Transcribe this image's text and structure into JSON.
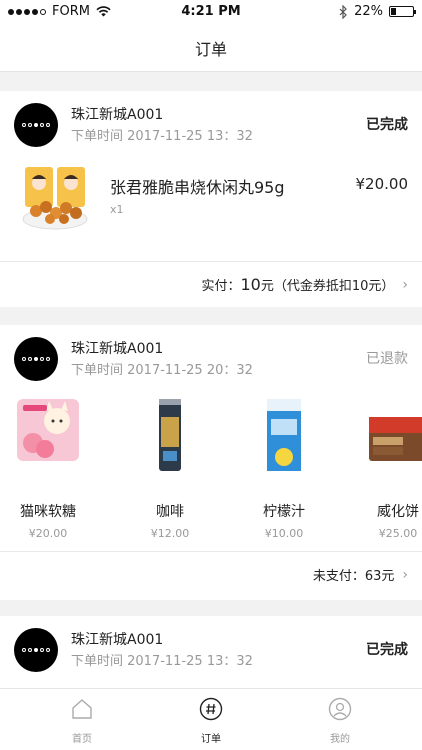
{
  "status_bar": {
    "carrier": "FORM",
    "time": "4:21 PM",
    "battery": "22%",
    "battery_level": 0.22
  },
  "nav": {
    "title": "订单"
  },
  "orders": [
    {
      "store": "珠江新城A001",
      "time": "下单时间 2017-11-25 13：32",
      "status": "已完成",
      "item": {
        "name": "张君雅脆串烧休闲丸95g",
        "qty": "x1",
        "price": "¥20.00"
      },
      "footer": {
        "label": "实付：",
        "amount": "10",
        "unit": "元",
        "note": "（代金券抵扣10元）"
      }
    },
    {
      "store": "珠江新城A001",
      "time": "下单时间 2017-11-25 20：32",
      "status": "已退款",
      "products": [
        {
          "name": "猫咪软糖",
          "price": "¥20.00"
        },
        {
          "name": "咖啡",
          "price": "¥12.00"
        },
        {
          "name": "柠檬汁",
          "price": "¥10.00"
        },
        {
          "name": "威化饼",
          "price": "¥25.00"
        }
      ],
      "footer": {
        "label": "未支付：63元"
      }
    },
    {
      "store": "珠江新城A001",
      "time": "下单时间 2017-11-25 13：32",
      "status": "已完成"
    }
  ],
  "tabs": [
    {
      "label": "首页",
      "icon": "home-icon"
    },
    {
      "label": "订单",
      "icon": "order-hash-icon"
    },
    {
      "label": "我的",
      "icon": "profile-icon"
    }
  ],
  "colors": {
    "text": "#222222",
    "muted": "#999999",
    "background": "#f2f2f2"
  }
}
